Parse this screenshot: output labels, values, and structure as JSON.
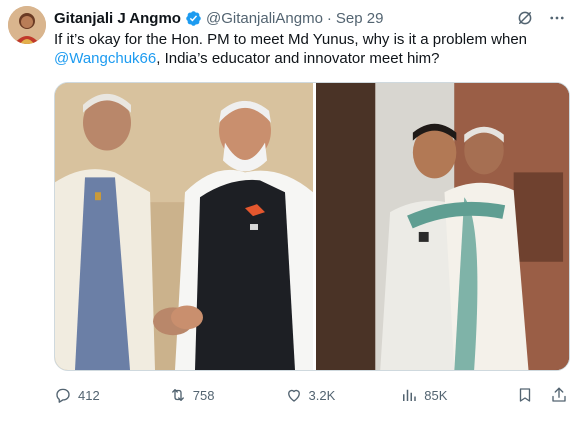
{
  "author": {
    "name": "Gitanjali J Angmo",
    "handle": "@GitanjaliAngmo",
    "separator": "·",
    "date": "Sep 29",
    "verified": true
  },
  "tweet": {
    "text_before": "If it’s okay for the Hon. PM to meet Md Yunus, why is it a problem when ",
    "mention": "@Wangchuk66",
    "text_after": ", India’s educator and innovator meet him?"
  },
  "media": {
    "photo_count": 2
  },
  "actions": {
    "replies": "412",
    "reposts": "758",
    "likes": "3.2K",
    "views": "85K"
  },
  "icons": {
    "verified": "verified-badge-icon",
    "grok": "grok-icon",
    "more": "more-icon",
    "reply": "reply-icon",
    "repost": "repost-icon",
    "like": "heart-icon",
    "views": "views-icon",
    "bookmark": "bookmark-icon",
    "share": "share-icon"
  },
  "colors": {
    "accent": "#1d9bf0",
    "text": "#0f1419",
    "secondary": "#536471"
  }
}
